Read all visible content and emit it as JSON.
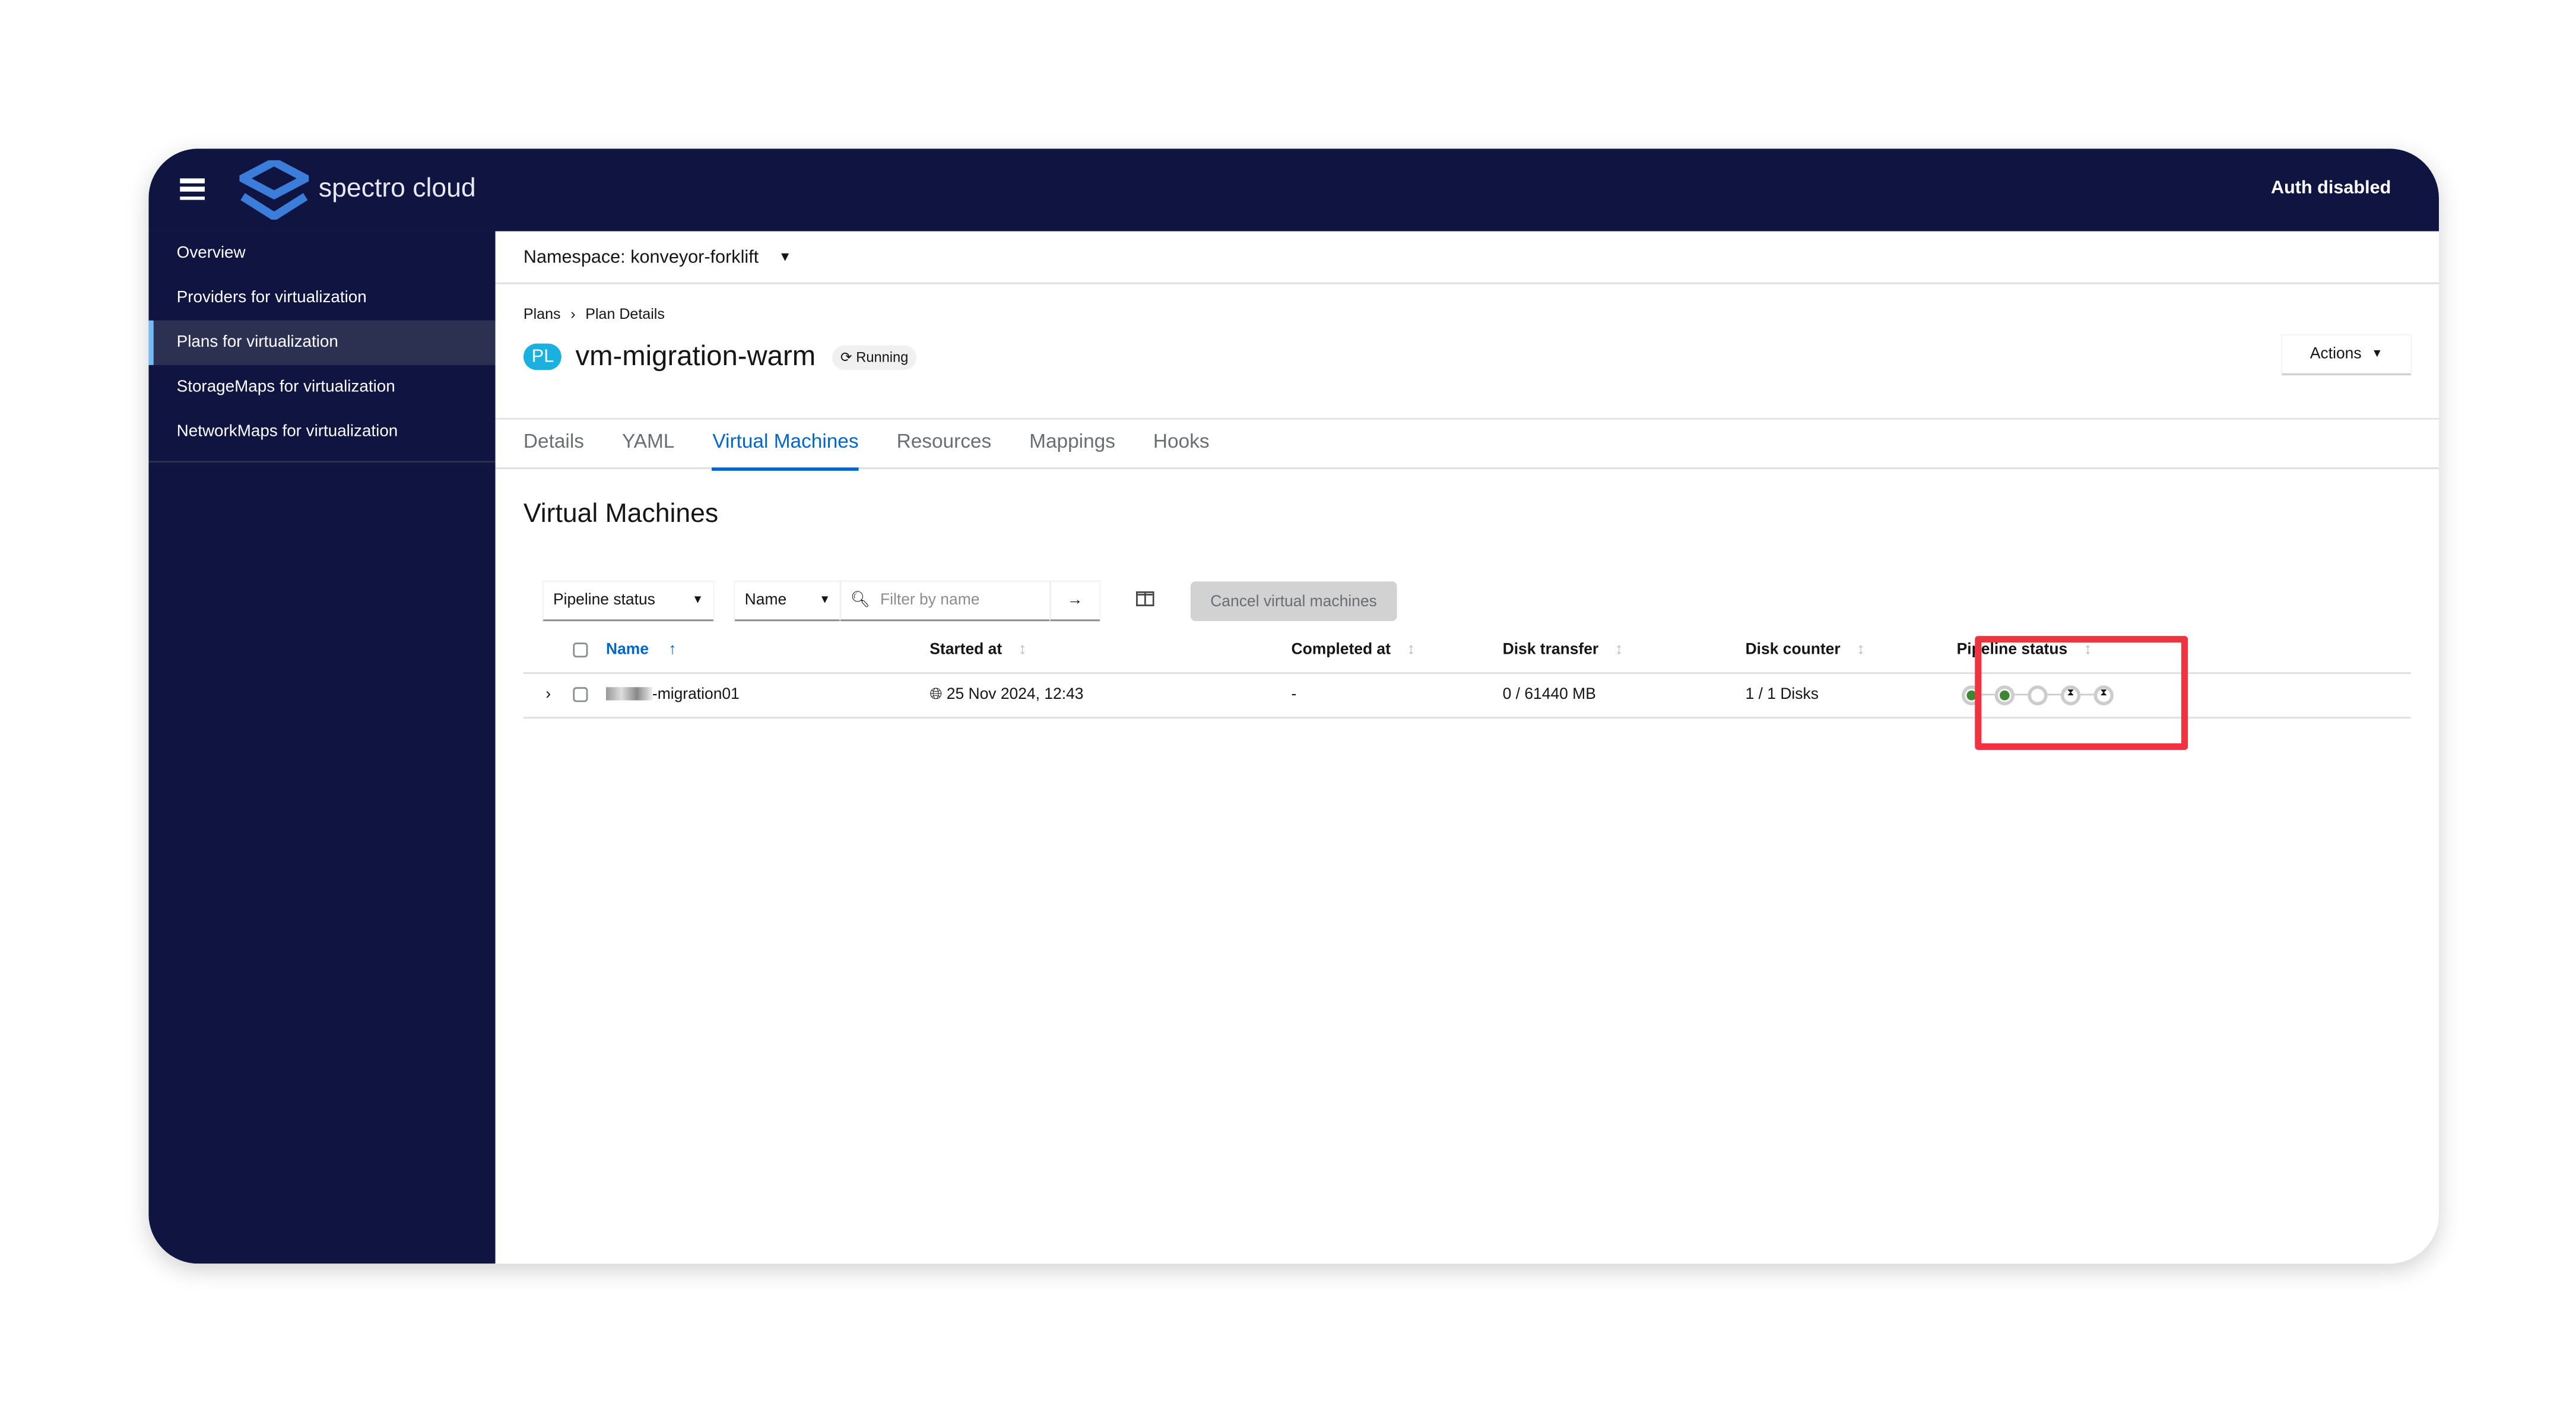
{
  "header": {
    "brand": "spectro cloud",
    "auth": "Auth disabled"
  },
  "sidebar": {
    "items": [
      {
        "label": "Overview"
      },
      {
        "label": "Providers for virtualization"
      },
      {
        "label": "Plans for virtualization",
        "active": true
      },
      {
        "label": "StorageMaps for virtualization"
      },
      {
        "label": "NetworkMaps for virtualization"
      }
    ]
  },
  "namespace": "Namespace: konveyor-forklift",
  "breadcrumb": {
    "parent": "Plans",
    "separator": "›",
    "current": "Plan Details"
  },
  "plan": {
    "badge": "PL",
    "name": "vm-migration-warm",
    "status": "Running"
  },
  "actions_label": "Actions",
  "tabs": [
    "Details",
    "YAML",
    "Virtual Machines",
    "Resources",
    "Mappings",
    "Hooks"
  ],
  "active_tab": "Virtual Machines",
  "section_title": "Virtual Machines",
  "toolbar": {
    "filter_type": "Pipeline status",
    "attribute": "Name",
    "search_placeholder": "Filter by name",
    "cancel": "Cancel virtual machines"
  },
  "table": {
    "headers": [
      "Name",
      "Started at",
      "Completed at",
      "Disk transfer",
      "Disk counter",
      "Pipeline status"
    ],
    "rows": [
      {
        "name": "-migration01",
        "started": "25 Nov 2024, 12:43",
        "completed": "-",
        "disk_transfer": "0 / 61440 MB",
        "disk_counter": "1 / 1 Disks",
        "pipeline": [
          "done",
          "done",
          "pending",
          "waiting",
          "waiting"
        ]
      }
    ]
  },
  "colors": {
    "nav": "#0f1441",
    "accent": "#0066cc",
    "highlight": "#ef3340",
    "success": "#3e8635"
  }
}
